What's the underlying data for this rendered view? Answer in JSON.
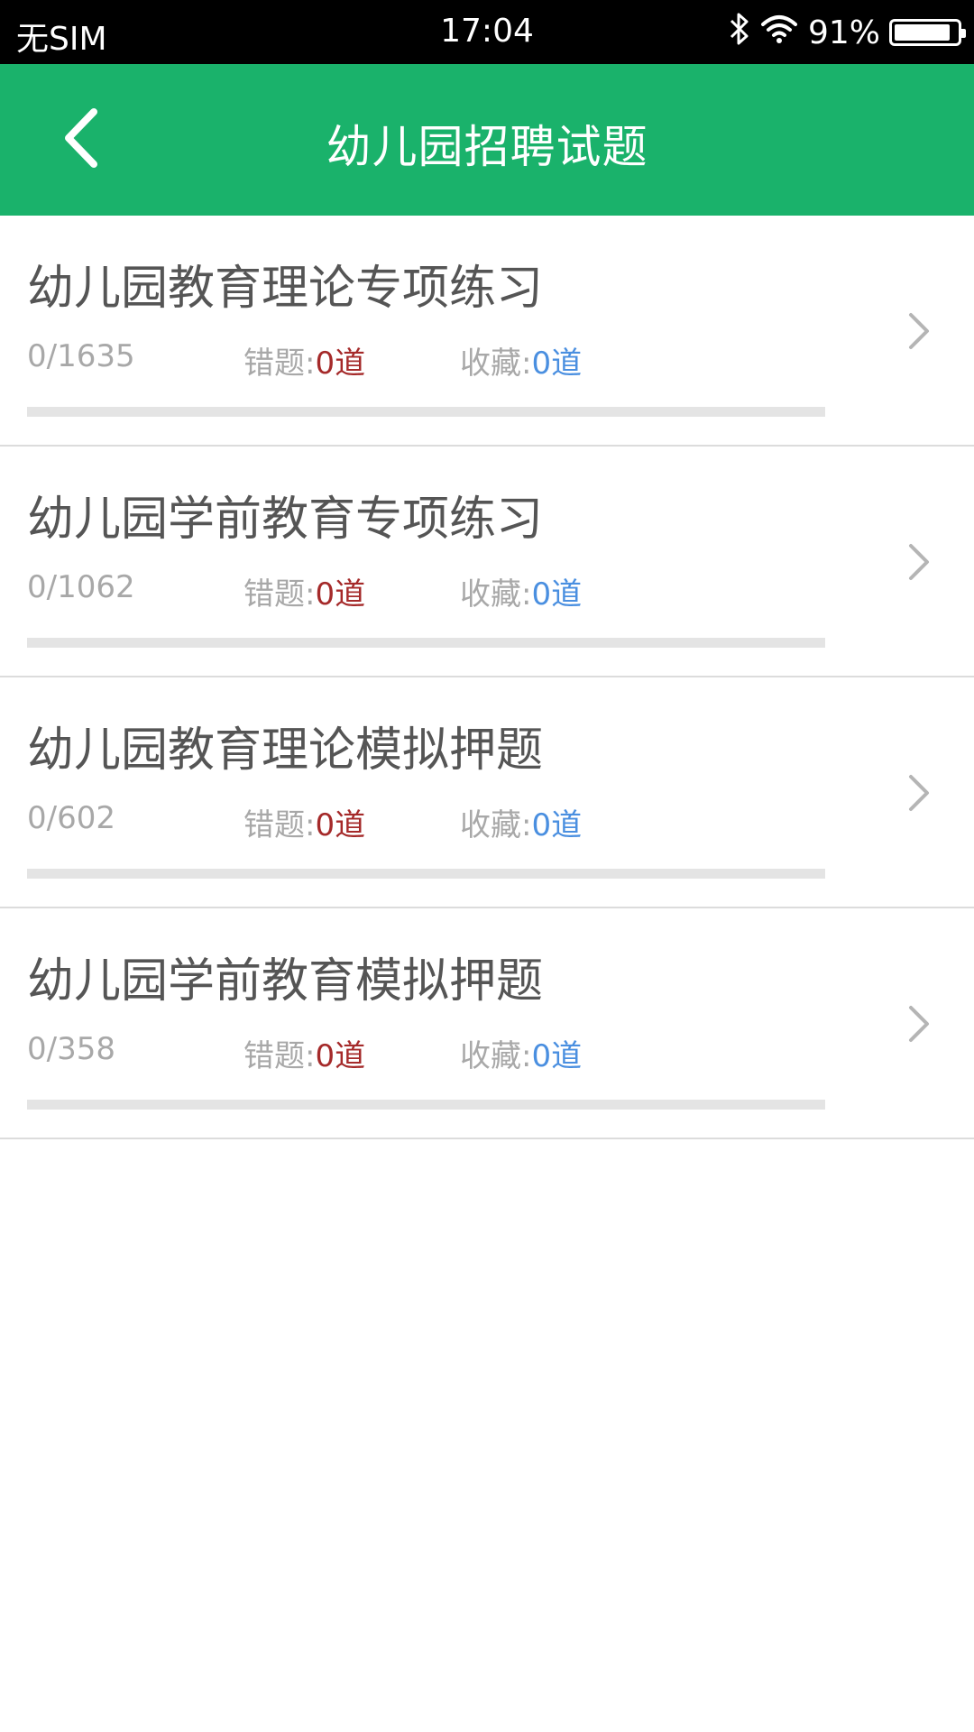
{
  "status_bar": {
    "carrier": "无SIM",
    "time": "17:04",
    "battery_percent": "91%",
    "battery_level": 0.91,
    "icons": [
      "bluetooth-icon",
      "wifi-icon",
      "battery-icon"
    ]
  },
  "header": {
    "title": "幼儿园招聘试题",
    "back_icon": "chevron-left-icon",
    "background_color": "#1AB26B"
  },
  "colors": {
    "accent_green": "#1AB26B",
    "wrong_value": "#A52A2A",
    "favorite_value": "#4A8FE0",
    "label_gray": "#A8A8A8",
    "title_gray": "#555555"
  },
  "labels": {
    "wrong": "错题:",
    "favorite": "收藏:"
  },
  "items": [
    {
      "title": "幼儿园教育理论专项练习",
      "progress_text": "0/1635",
      "progress_fraction": 0,
      "wrong_count": "0道",
      "favorite_count": "0道"
    },
    {
      "title": "幼儿园学前教育专项练习",
      "progress_text": "0/1062",
      "progress_fraction": 0,
      "wrong_count": "0道",
      "favorite_count": "0道"
    },
    {
      "title": "幼儿园教育理论模拟押题",
      "progress_text": "0/602",
      "progress_fraction": 0,
      "wrong_count": "0道",
      "favorite_count": "0道"
    },
    {
      "title": "幼儿园学前教育模拟押题",
      "progress_text": "0/358",
      "progress_fraction": 0,
      "wrong_count": "0道",
      "favorite_count": "0道"
    }
  ]
}
